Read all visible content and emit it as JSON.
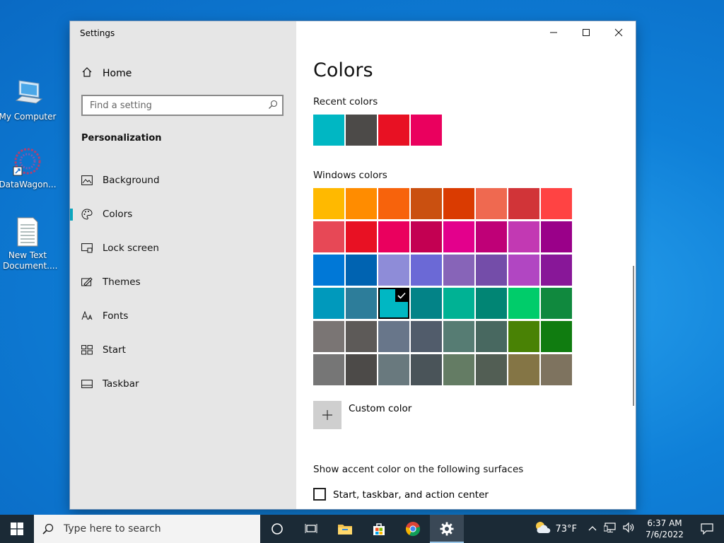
{
  "desktop": {
    "icons": [
      {
        "label": "My Computer"
      },
      {
        "label": "DataWagon..."
      },
      {
        "label": "New Text Document...."
      }
    ]
  },
  "window": {
    "title": "Settings",
    "sidebar": {
      "home": "Home",
      "search_placeholder": "Find a setting",
      "section": "Personalization",
      "items": [
        {
          "label": "Background",
          "icon": "image-icon"
        },
        {
          "label": "Colors",
          "icon": "palette-icon",
          "active": true
        },
        {
          "label": "Lock screen",
          "icon": "lock-screen-icon"
        },
        {
          "label": "Themes",
          "icon": "themes-icon"
        },
        {
          "label": "Fonts",
          "icon": "fonts-icon"
        },
        {
          "label": "Start",
          "icon": "start-icon"
        },
        {
          "label": "Taskbar",
          "icon": "taskbar-icon"
        }
      ]
    },
    "content": {
      "heading": "Colors",
      "recent_label": "Recent colors",
      "recent_colors": [
        "#00b7c3",
        "#4c4a48",
        "#e81123",
        "#ea005e"
      ],
      "windows_label": "Windows colors",
      "windows_colors": [
        [
          "#ffb900",
          "#ff8c00",
          "#f7630c",
          "#ca5010",
          "#da3b01",
          "#ef6950",
          "#d13438",
          "#ff4343"
        ],
        [
          "#e74856",
          "#e81123",
          "#ea005e",
          "#c30052",
          "#e3008c",
          "#bf0077",
          "#c239b3",
          "#9a0089"
        ],
        [
          "#0078d7",
          "#0063b1",
          "#8e8cd8",
          "#6b69d6",
          "#8764b8",
          "#744da9",
          "#b146c2",
          "#881798"
        ],
        [
          "#0099bc",
          "#2d7d9a",
          "#00b7c3",
          "#038387",
          "#00b294",
          "#018574",
          "#00cc6a",
          "#10893e"
        ],
        [
          "#7a7574",
          "#5d5a58",
          "#68768a",
          "#515c6b",
          "#567c73",
          "#486860",
          "#498205",
          "#107c10"
        ],
        [
          "#767676",
          "#4c4a48",
          "#69797e",
          "#4a5459",
          "#647c64",
          "#525e54",
          "#847545",
          "#7e735f"
        ]
      ],
      "selected": {
        "row": 3,
        "col": 2
      },
      "custom_color_label": "Custom color",
      "surfaces_label": "Show accent color on the following surfaces",
      "checkbox_label": "Start, taskbar, and action center",
      "checkbox_checked": false
    }
  },
  "taskbar": {
    "search_placeholder": "Type here to search",
    "weather": "73°F",
    "time": "6:37 AM",
    "date": "7/6/2022"
  }
}
